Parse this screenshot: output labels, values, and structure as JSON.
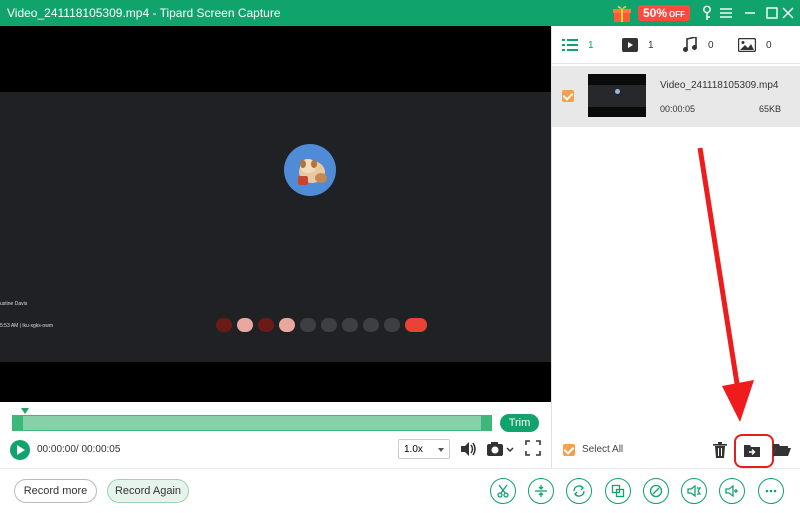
{
  "window": {
    "title": "Video_241118105309.mp4  -  Tipard Screen Capture",
    "promo_percent": "50%",
    "promo_off": "OFF"
  },
  "meeting": {
    "participant_name": "ustine Davis",
    "time_and_code": "5:53 AM  |  iku-xgks-owm"
  },
  "timeline": {
    "trim_label": "Trim",
    "timecode": "00:00:00/ 00:00:05",
    "speed": "1.0x"
  },
  "bottom": {
    "record_more": "Record more",
    "record_again": "Record Again",
    "tools": [
      "scissors-icon",
      "merge-icon",
      "rotate-icon",
      "crop-icon",
      "edit-metadata-icon",
      "audio-compress-icon",
      "volume-boost-icon",
      "more-icon"
    ]
  },
  "panel": {
    "tabs": [
      {
        "icon": "list-icon",
        "count": "1"
      },
      {
        "icon": "video-icon",
        "count": "1"
      },
      {
        "icon": "music-icon",
        "count": "0"
      },
      {
        "icon": "image-icon",
        "count": "0"
      }
    ],
    "file": {
      "name": "Video_241118105309.mp4",
      "duration": "00:00:05",
      "size": "65KB"
    },
    "select_all": "Select All"
  },
  "colors": {
    "brand": "#10a36b",
    "checkbox": "#f5a04a",
    "highlight": "#e02020",
    "promo": "#ff4a3d"
  }
}
